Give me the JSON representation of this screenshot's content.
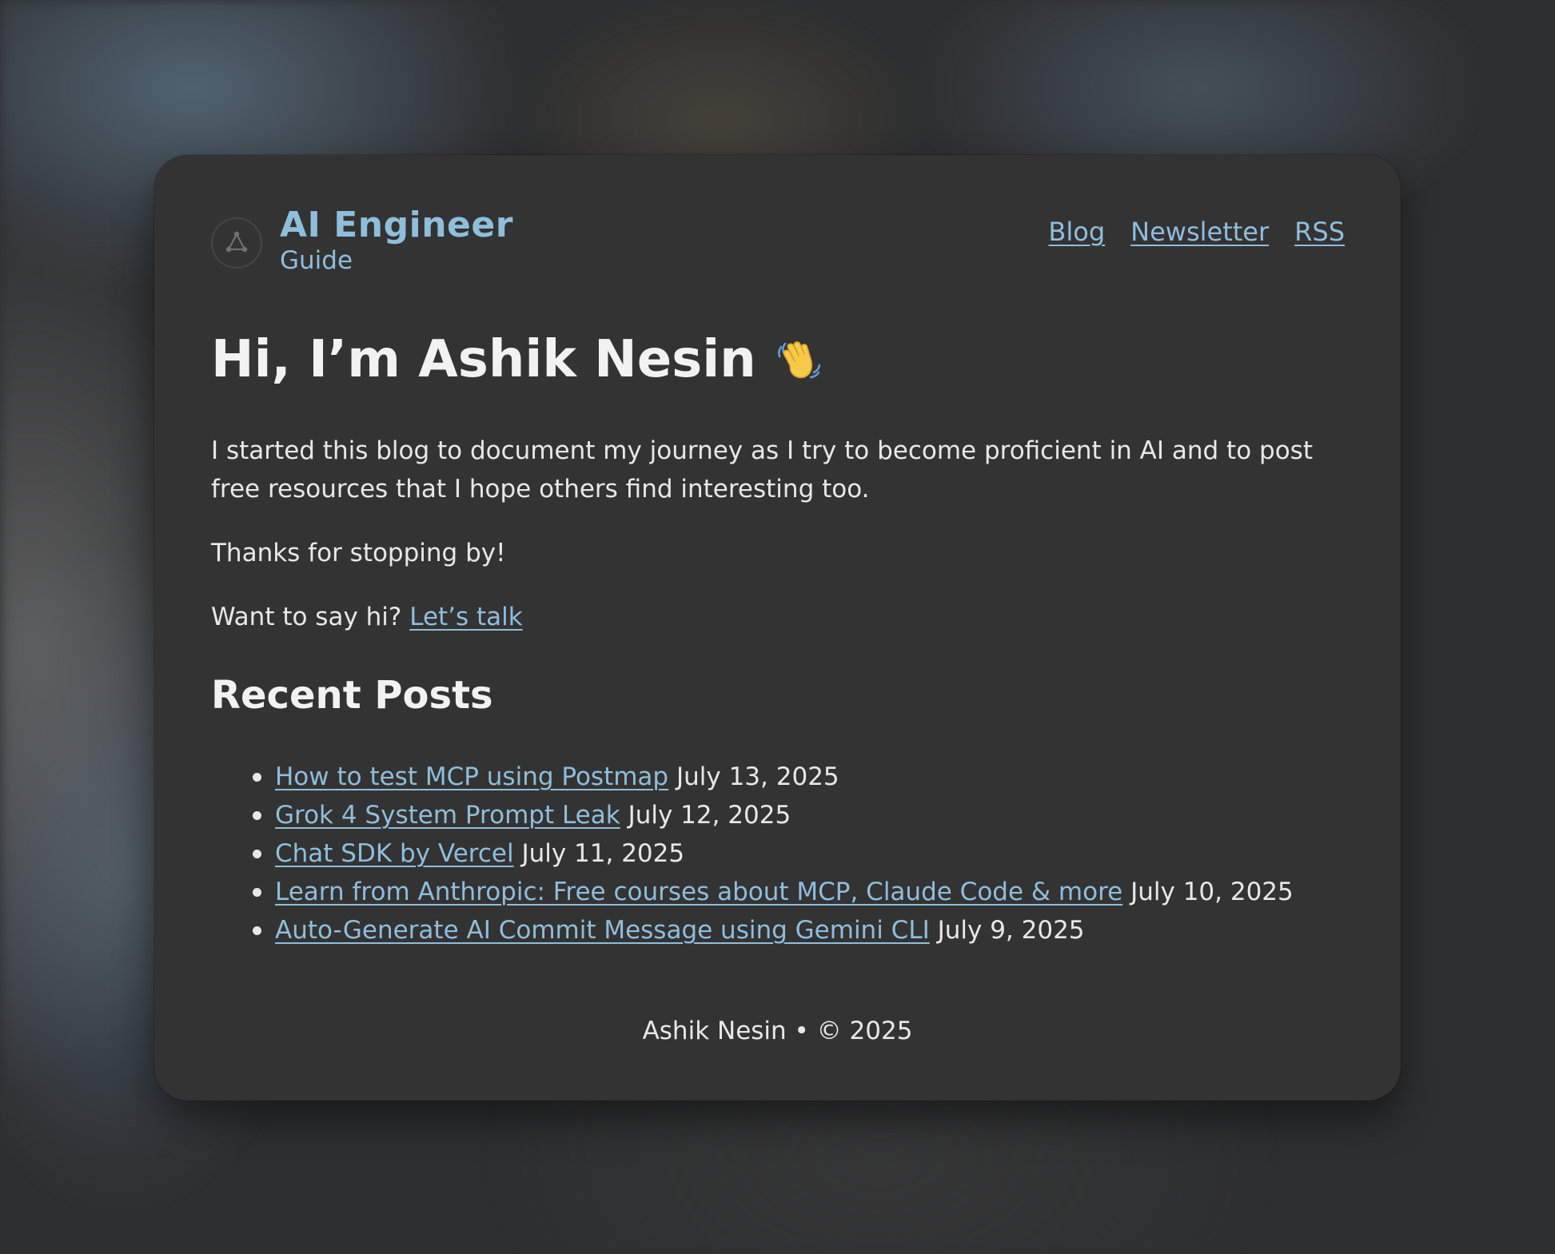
{
  "site": {
    "title": "AI Engineer",
    "subtitle": "Guide",
    "logo_icon": "network-triangle-icon"
  },
  "nav": {
    "items": [
      {
        "label": "Blog"
      },
      {
        "label": "Newsletter"
      },
      {
        "label": "RSS"
      }
    ]
  },
  "hero": {
    "heading": "Hi, I’m Ashik Nesin",
    "emoji_icon": "waving-hand-icon"
  },
  "intro": {
    "paragraph1": "I started this blog to document my journey as I try to become proficient in AI and to post free resources that I hope others find interesting too.",
    "paragraph2": "Thanks for stopping by!",
    "cta_prefix": "Want to say hi?",
    "cta_link": "Let’s talk"
  },
  "recent_posts": {
    "title": "Recent Posts",
    "items": [
      {
        "title": "How to test MCP using Postmap",
        "date": "July 13, 2025"
      },
      {
        "title": "Grok 4 System Prompt Leak",
        "date": "July 12, 2025"
      },
      {
        "title": "Chat SDK by Vercel",
        "date": "July 11, 2025"
      },
      {
        "title": "Learn from Anthropic: Free courses about MCP, Claude Code & more",
        "date": "July 10, 2025"
      },
      {
        "title": "Auto-Generate AI Commit Message using Gemini CLI",
        "date": "July 9, 2025"
      }
    ]
  },
  "footer": {
    "text": "Ashik Nesin • © 2025"
  },
  "colors": {
    "accent": "#8fbedb",
    "card_bg": "#333333",
    "text": "#e8e8e8",
    "heading": "#f2f2f2"
  }
}
